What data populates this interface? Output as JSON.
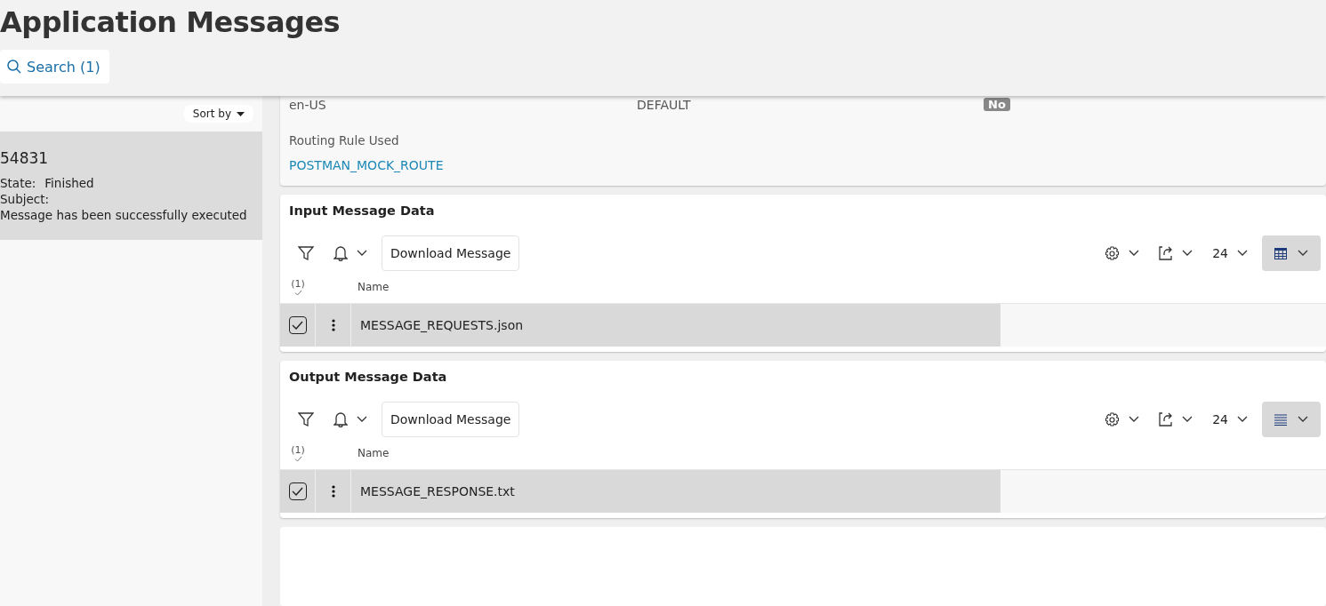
{
  "header": {
    "title": "Application Messages",
    "search_button": "Search (1)"
  },
  "list": {
    "sort_label": "Sort by",
    "items": [
      {
        "id": "54831",
        "state_label": "State:",
        "state": "Finished",
        "subject_label": "Subject:",
        "subject": "Message has been successfully executed",
        "selected": true
      }
    ]
  },
  "details": {
    "values": [
      "en-US",
      "DEFAULT"
    ],
    "badge": "No",
    "routing_label": "Routing Rule Used",
    "routing_value": "POSTMAN_MOCK_ROUTE"
  },
  "tables": [
    {
      "title": "Input Message Data",
      "download_button": "Download Message",
      "page_size": "24",
      "view": {
        "kind": "grid"
      },
      "selected_count": "(1)",
      "column": "Name",
      "rows": [
        {
          "name": "MESSAGE_REQUESTS.json",
          "checked": true,
          "selected": true
        }
      ]
    },
    {
      "title": "Output Message Data",
      "download_button": "Download Message",
      "page_size": "24",
      "view": {
        "kind": "list"
      },
      "selected_count": "(1)",
      "column": "Name",
      "rows": [
        {
          "name": "MESSAGE_RESPONSE.txt",
          "checked": true,
          "selected": true
        }
      ]
    }
  ]
}
